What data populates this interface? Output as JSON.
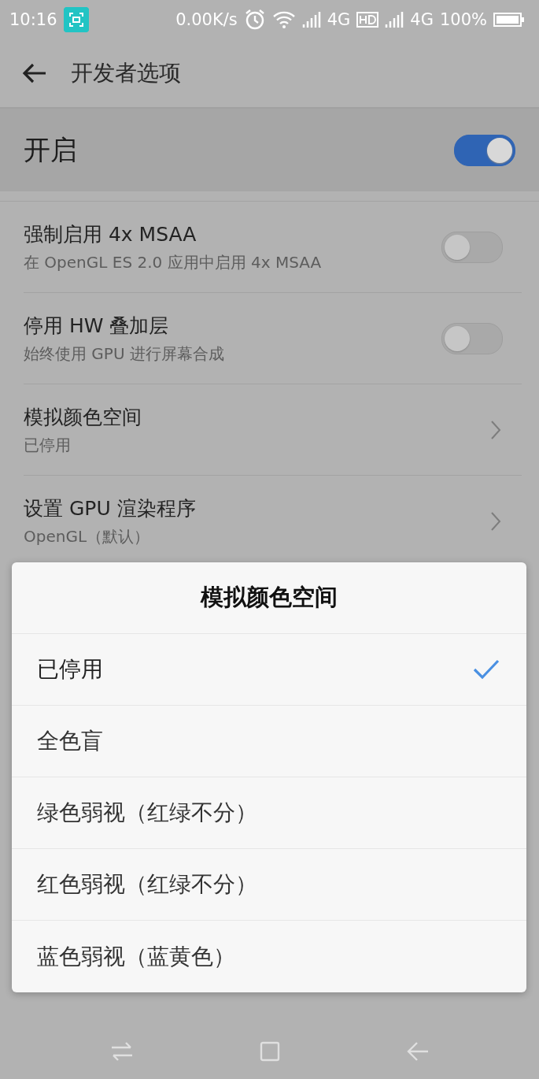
{
  "status_bar": {
    "time": "10:16",
    "speed": "0.00K/s",
    "network_1": "4G",
    "network_2": "4G",
    "battery": "100%"
  },
  "toolbar": {
    "title": "开发者选项"
  },
  "master_switch": {
    "label": "开启",
    "on": true
  },
  "settings": [
    {
      "kind": "switch",
      "title": "强制启用 4x MSAA",
      "subtitle": "在 OpenGL ES 2.0 应用中启用 4x MSAA",
      "on": false
    },
    {
      "kind": "switch",
      "title": "停用 HW 叠加层",
      "subtitle": "始终使用 GPU 进行屏幕合成",
      "on": false
    },
    {
      "kind": "link",
      "title": "模拟颜色空间",
      "subtitle": "已停用"
    },
    {
      "kind": "link",
      "title": "设置 GPU 渲染程序",
      "subtitle": "OpenGL（默认）"
    }
  ],
  "dialog": {
    "title": "模拟颜色空间",
    "options": [
      {
        "label": "已停用",
        "selected": true
      },
      {
        "label": "全色盲",
        "selected": false
      },
      {
        "label": "绿色弱视（红绿不分）",
        "selected": false
      },
      {
        "label": "红色弱视（红绿不分）",
        "selected": false
      },
      {
        "label": "蓝色弱视（蓝黄色）",
        "selected": false
      }
    ]
  }
}
